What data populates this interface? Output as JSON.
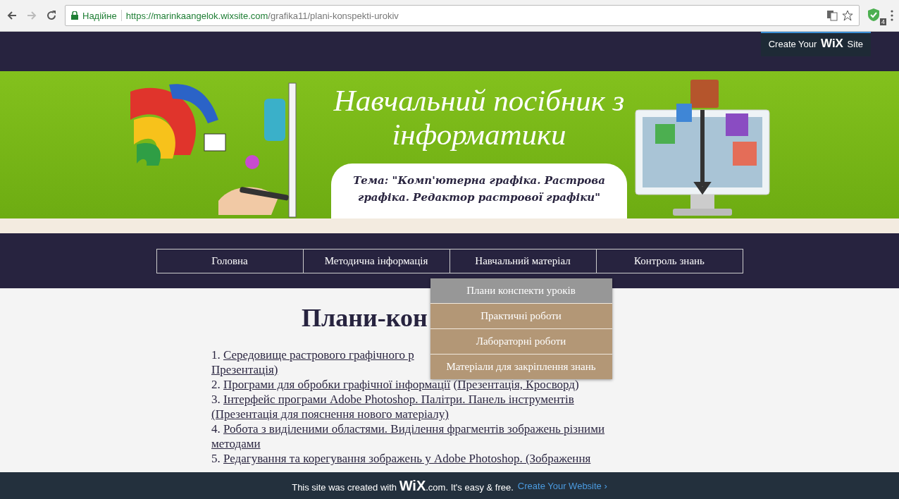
{
  "browser": {
    "security_label": "Надійне",
    "url_host": "https://marinkaangelok.wixsite.com",
    "url_path": "/grafika11/plani-konspekti-urokiv",
    "extension_badge": "4"
  },
  "header": {
    "promo_button": {
      "prefix": "Create Your",
      "brand": "WiX",
      "suffix": "Site"
    }
  },
  "banner": {
    "title": "Навчальний посібник з інформатики",
    "subtitle": "Тема:  \"Комп'ютерна графіка. Растрова графіка. Редактор растрової графіки\""
  },
  "nav": {
    "items": [
      {
        "label": "Головна"
      },
      {
        "label": "Методична інформація"
      },
      {
        "label": "Навчальний матеріал",
        "submenu": [
          {
            "label": "Плани конспекти уроків",
            "selected": true
          },
          {
            "label": "Практичні роботи",
            "selected": false
          },
          {
            "label": "Лабораторні роботи",
            "selected": false
          },
          {
            "label": "Матеріали для закріплення знань",
            "selected": false
          }
        ]
      },
      {
        "label": "Контроль знань"
      }
    ]
  },
  "content": {
    "heading": "Плани-кон",
    "items": [
      {
        "number": "1.",
        "parts": [
          {
            "text": "Середовище растрового графічного р",
            "link": true
          },
          {
            "text": "Презентація)",
            "link": true,
            "new_line": true
          }
        ]
      },
      {
        "number": "2.",
        "parts": [
          {
            "text": "Програми для обробки графічної інформації",
            "link": true
          },
          {
            "text": " (",
            "link": false
          },
          {
            "text": "Презентація, Кросворд",
            "link": true
          },
          {
            "text": ")",
            "link": false
          }
        ]
      },
      {
        "number": "3.",
        "parts": [
          {
            "text": "Інтерфейс програми Adobe Photoshop. Палітри. Панель інструментів ",
            "link": true
          },
          {
            "text": "(Презентація для пояснення нового матеріалу)",
            "link": true,
            "new_line": true
          }
        ]
      },
      {
        "number": "4.",
        "parts": [
          {
            "text": "Робота з виділеними областями. Виділення фрагментів зображень різними",
            "link": true
          },
          {
            "text": "методами",
            "link": true,
            "new_line": true
          }
        ]
      },
      {
        "number": "5.",
        "parts": [
          {
            "text": "Редагування та корегування зображень у Adobe Photoshop. (Зображення",
            "link": true
          }
        ]
      }
    ]
  },
  "footer": {
    "text": "This site was created with **WiX**.com. It's easy & free.",
    "link": "Create Your Website ›"
  }
}
